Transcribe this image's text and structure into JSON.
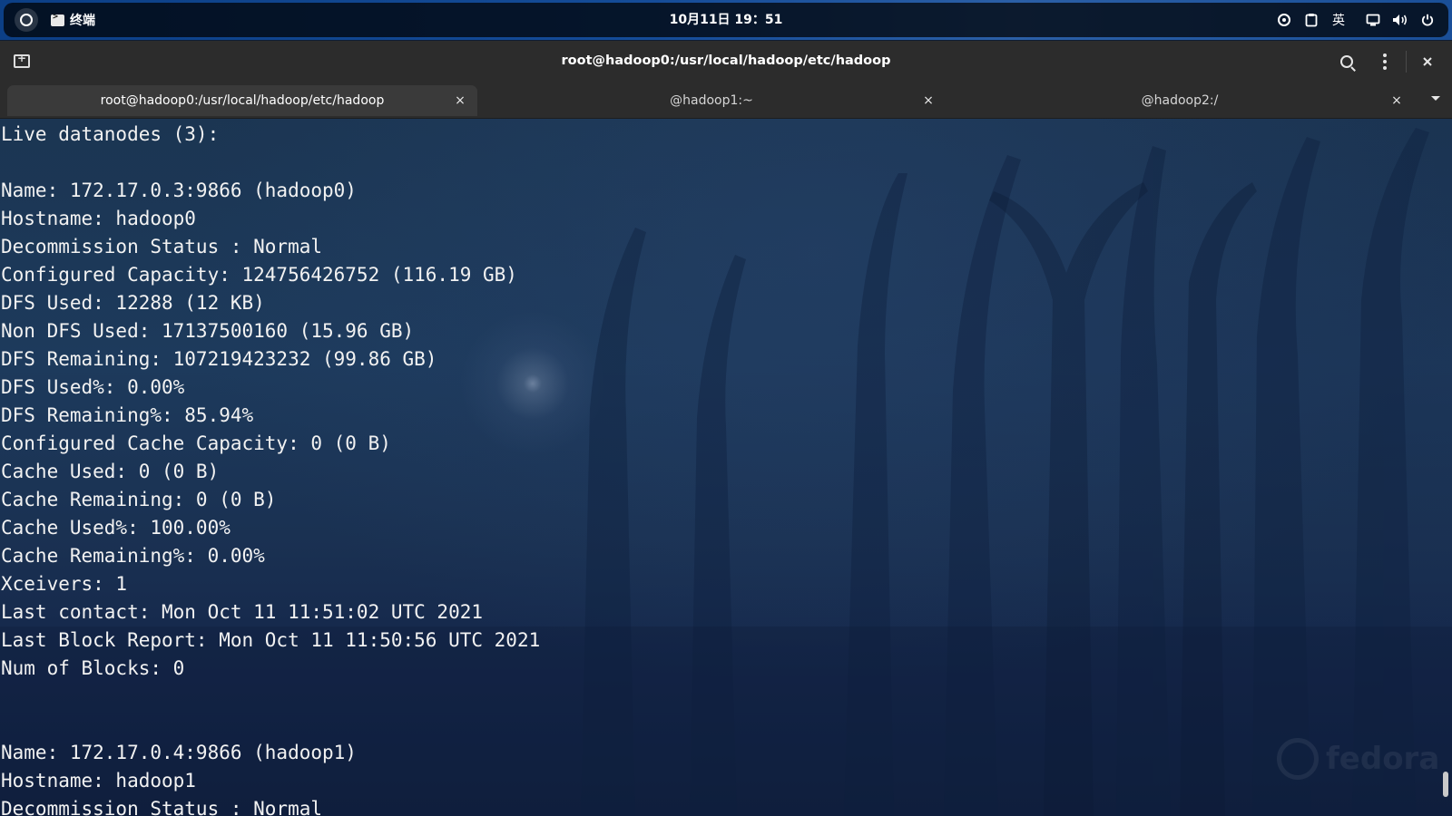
{
  "topbar": {
    "app_name": "终端",
    "clock": "10月11日 19：51",
    "input_method": "英"
  },
  "window": {
    "title": "root@hadoop0:/usr/local/hadoop/etc/hadoop",
    "tabs": [
      {
        "label": "root@hadoop0:/usr/local/hadoop/etc/hadoop",
        "close": "×",
        "active": true
      },
      {
        "label": "@hadoop1:~",
        "close": "×",
        "active": false
      },
      {
        "label": "@hadoop2:/",
        "close": "×",
        "active": false
      }
    ]
  },
  "terminal": {
    "lines": [
      "Live datanodes (3):",
      "",
      "Name: 172.17.0.3:9866 (hadoop0)",
      "Hostname: hadoop0",
      "Decommission Status : Normal",
      "Configured Capacity: 124756426752 (116.19 GB)",
      "DFS Used: 12288 (12 KB)",
      "Non DFS Used: 17137500160 (15.96 GB)",
      "DFS Remaining: 107219423232 (99.86 GB)",
      "DFS Used%: 0.00%",
      "DFS Remaining%: 85.94%",
      "Configured Cache Capacity: 0 (0 B)",
      "Cache Used: 0 (0 B)",
      "Cache Remaining: 0 (0 B)",
      "Cache Used%: 100.00%",
      "Cache Remaining%: 0.00%",
      "Xceivers: 1",
      "Last contact: Mon Oct 11 11:51:02 UTC 2021",
      "Last Block Report: Mon Oct 11 11:50:56 UTC 2021",
      "Num of Blocks: 0",
      "",
      "",
      "Name: 172.17.0.4:9866 (hadoop1)",
      "Hostname: hadoop1",
      "Decommission Status : Normal"
    ],
    "wallpaper_watermark": "fedora"
  },
  "colors": {
    "topbar_accent": "#154c98",
    "headerbar": "#2c2c2c",
    "terminal_fg": "#f2f2f2"
  }
}
